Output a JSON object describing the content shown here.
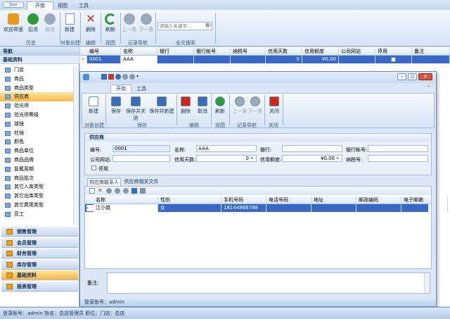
{
  "qat": {
    "label": "▯▫▫"
  },
  "main_tabs": [
    "开始",
    "视图",
    "工具"
  ],
  "ribbon": {
    "buttons": [
      "欢迎界面",
      "后退",
      "前进",
      "新建",
      "删除",
      "刷新",
      "上一条",
      "下一条"
    ],
    "search_placeholder": "请输入关键字...",
    "search_btn": "搜!",
    "groups": [
      "历史",
      "对象创建",
      "编辑",
      "视图",
      "记录导航",
      "全文搜索"
    ]
  },
  "nav": {
    "title": "导航",
    "section": "基础资料",
    "items": [
      "门店",
      "商品",
      "商品类型",
      "供应商",
      "验光师",
      "验光师等级",
      "球镜",
      "柱镜",
      "颜色",
      "商品单位",
      "商品品牌",
      "复戴周期",
      "商品批次",
      "其它入库类型",
      "其它出库类型",
      "其它费用类型",
      "员工"
    ],
    "selected": "供应商",
    "modules": [
      "销售管理",
      "会员管理",
      "财务管理",
      "库存管理",
      "基础资料",
      "报表管理"
    ],
    "active_module": "基础资料"
  },
  "main_grid": {
    "headers": [
      "编号",
      "名称",
      "银行",
      "银行帐号",
      "纳税号",
      "信用天数",
      "信用额度",
      "公司网站",
      "停用",
      "备注"
    ],
    "row": [
      "0001",
      "AAA",
      "",
      "",
      "",
      "0",
      "¥0.00",
      "",
      "",
      ""
    ]
  },
  "dialog": {
    "tabs": [
      "开始",
      "工具"
    ],
    "buttons": [
      "新建",
      "保存",
      "保存并关闭",
      "保存并新建",
      "删除",
      "取消",
      "刷新",
      "上一条",
      "下一条",
      "关闭"
    ],
    "groups": [
      "对象创建",
      "保存",
      "编辑",
      "视图",
      "记录导航",
      "关闭"
    ],
    "panel_title": "供应商",
    "fields": {
      "code_label": "编号:",
      "code": "0001",
      "name_label": "名称:",
      "name": "AAA",
      "bank_label": "银行:",
      "bank": "",
      "acct_label": "银行帐号:",
      "acct": "",
      "site_label": "公司网站:",
      "site": "",
      "days_label": "信用天数:",
      "days": "0",
      "limit_label": "信用额度:",
      "limit": "¥0.00",
      "tax_label": "纳税号:",
      "tax": "",
      "disabled_label": "停用"
    },
    "subtabs": [
      "供应商联系人",
      "供应商相关文件"
    ],
    "sub_headers": [
      "名称",
      "性别",
      "手机号码",
      "电话号码",
      "地址",
      "邮政编码",
      "电子邮箱"
    ],
    "sub_row": [
      "江小姐",
      "女",
      "18144866788",
      "",
      "",
      "",
      ""
    ],
    "notes_label": "备注:",
    "status": "登录账号：admin"
  },
  "statusbar": "登录账号：admin  姓名：总店管理员  职位：门店：总店"
}
